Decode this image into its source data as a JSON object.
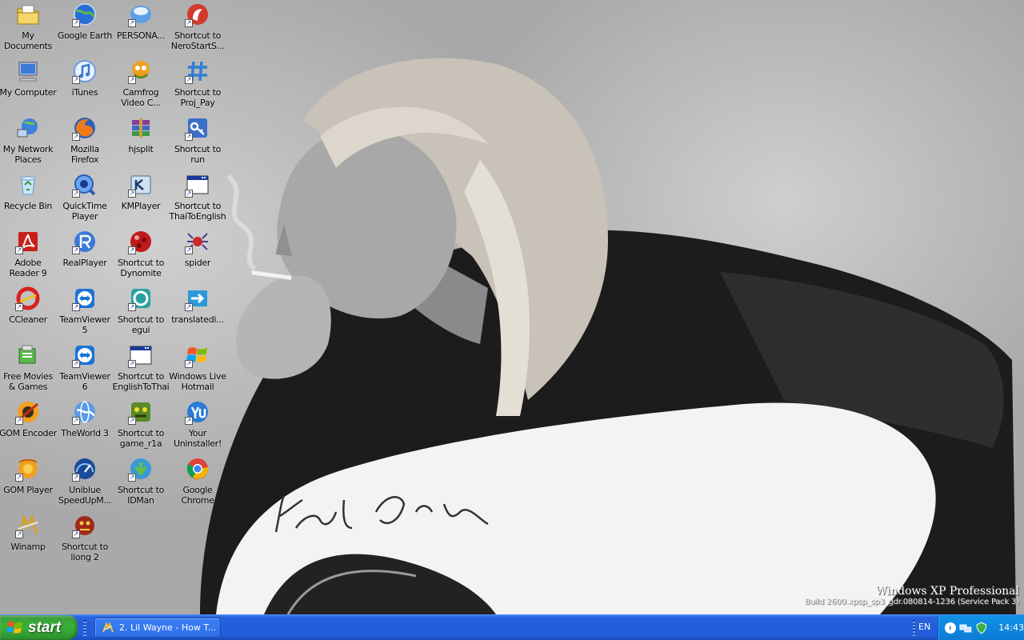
{
  "desktop": {
    "icons": [
      {
        "label": "My Documents",
        "icon": "folder-documents-icon",
        "shortcut": false
      },
      {
        "label": "Google Earth",
        "icon": "globe-icon",
        "shortcut": true
      },
      {
        "label": "PERSONA...",
        "icon": "persona-icon",
        "shortcut": true
      },
      {
        "label": "Shortcut to NeroStartS...",
        "icon": "nero-icon",
        "shortcut": true
      },
      {
        "label": "My Computer",
        "icon": "computer-icon",
        "shortcut": false
      },
      {
        "label": "iTunes",
        "icon": "itunes-icon",
        "shortcut": true
      },
      {
        "label": "Camfrog Video C...",
        "icon": "camfrog-icon",
        "shortcut": true
      },
      {
        "label": "Shortcut to Proj_Pay",
        "icon": "hash-icon",
        "shortcut": true
      },
      {
        "label": "My Network Places",
        "icon": "network-icon",
        "shortcut": false
      },
      {
        "label": "Mozilla Firefox",
        "icon": "firefox-icon",
        "shortcut": true
      },
      {
        "label": "hjsplit",
        "icon": "archive-icon",
        "shortcut": false
      },
      {
        "label": "Shortcut to run",
        "icon": "key-icon",
        "shortcut": true
      },
      {
        "label": "Recycle Bin",
        "icon": "recycle-bin-icon",
        "shortcut": false
      },
      {
        "label": "QuickTime Player",
        "icon": "quicktime-icon",
        "shortcut": true
      },
      {
        "label": "KMPlayer",
        "icon": "kmplayer-icon",
        "shortcut": true
      },
      {
        "label": "Shortcut to ThaiToEnglish",
        "icon": "console-window-icon",
        "shortcut": true
      },
      {
        "label": "Adobe Reader 9",
        "icon": "adobe-reader-icon",
        "shortcut": true
      },
      {
        "label": "RealPlayer",
        "icon": "realplayer-icon",
        "shortcut": true
      },
      {
        "label": "Shortcut to Dynomite",
        "icon": "dynomite-icon",
        "shortcut": true
      },
      {
        "label": "spider",
        "icon": "spider-icon",
        "shortcut": true
      },
      {
        "label": "CCleaner",
        "icon": "ccleaner-icon",
        "shortcut": true
      },
      {
        "label": "TeamViewer 5",
        "icon": "teamviewer-icon",
        "shortcut": true
      },
      {
        "label": "Shortcut to egui",
        "icon": "egui-icon",
        "shortcut": true
      },
      {
        "label": "translatedi...",
        "icon": "translate-icon",
        "shortcut": true
      },
      {
        "label": "Free Movies & Games",
        "icon": "free-movies-icon",
        "shortcut": false
      },
      {
        "label": "TeamViewer 6",
        "icon": "teamviewer-icon",
        "shortcut": true
      },
      {
        "label": "Shortcut to EnglishToThai",
        "icon": "console-window-icon",
        "shortcut": true
      },
      {
        "label": "Windows Live Hotmail",
        "icon": "windows-flag-icon",
        "shortcut": true
      },
      {
        "label": "GOM Encoder",
        "icon": "gom-encoder-icon",
        "shortcut": true
      },
      {
        "label": "TheWorld 3",
        "icon": "theworld-icon",
        "shortcut": true
      },
      {
        "label": "Shortcut to game_r1a",
        "icon": "game-icon",
        "shortcut": true
      },
      {
        "label": "Your Uninstaller!",
        "icon": "uninstaller-icon",
        "shortcut": true
      },
      {
        "label": "GOM Player",
        "icon": "gom-player-icon",
        "shortcut": true
      },
      {
        "label": "Uniblue SpeedUpM...",
        "icon": "speedometer-icon",
        "shortcut": true
      },
      {
        "label": "Shortcut to IDMan",
        "icon": "idman-icon",
        "shortcut": true
      },
      {
        "label": "Google Chrome",
        "icon": "chrome-icon",
        "shortcut": false
      },
      {
        "label": "Winamp",
        "icon": "winamp-icon",
        "shortcut": true
      },
      {
        "label": "Shortcut to liong 2",
        "icon": "liong-icon",
        "shortcut": true
      }
    ]
  },
  "watermark": {
    "os_name": "Windows XP Professional",
    "build": "Build 2600.xpsp_sp3_gdr.080814-1236 (Service Pack 3)"
  },
  "taskbar": {
    "start_label": "start",
    "task": {
      "label": "2. Lil Wayne - How T...",
      "icon": "winamp-icon"
    },
    "language": "EN",
    "tray_expand": "‹",
    "clock": "14:43"
  },
  "colors": {
    "taskbar_blue": "#245edb",
    "start_green": "#38b138",
    "tray_blue": "#0f8ae0"
  }
}
